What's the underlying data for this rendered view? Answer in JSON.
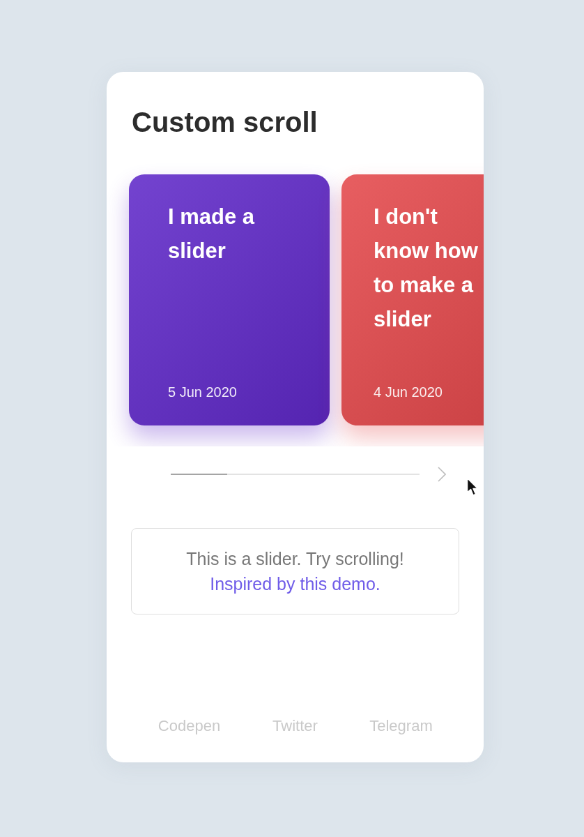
{
  "title": "Custom scroll",
  "slides": [
    {
      "title": "I made a slider",
      "date": "5 Jun 2020",
      "color": "#6029c9"
    },
    {
      "title": "I don't know how to make a slider",
      "date": "4 Jun 2020",
      "color": "#e4484b"
    }
  ],
  "info": {
    "text": "This is a slider. Try scrolling!",
    "link": "Inspired by this demo."
  },
  "footer_links": [
    "Codepen",
    "Twitter",
    "Telegram"
  ]
}
